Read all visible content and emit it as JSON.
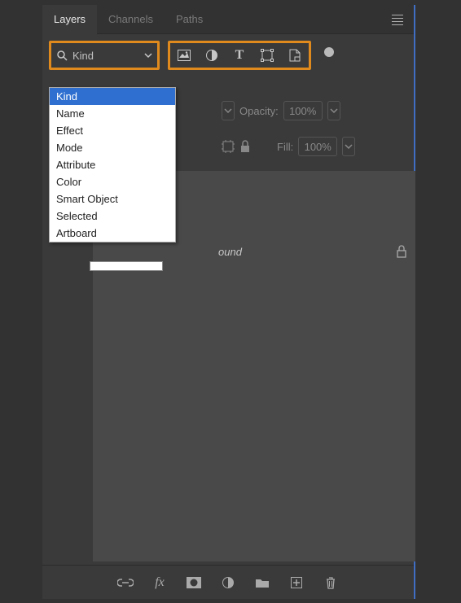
{
  "tabs": {
    "layers": "Layers",
    "channels": "Channels",
    "paths": "Paths"
  },
  "filter": {
    "label": "Kind",
    "options": [
      "Kind",
      "Name",
      "Effect",
      "Mode",
      "Attribute",
      "Color",
      "Smart Object",
      "Selected",
      "Artboard"
    ]
  },
  "opacity": {
    "label": "Opacity:",
    "value": "100%"
  },
  "fill": {
    "label": "Fill:",
    "value": "100%"
  },
  "layer": {
    "name_partial": "ound"
  }
}
